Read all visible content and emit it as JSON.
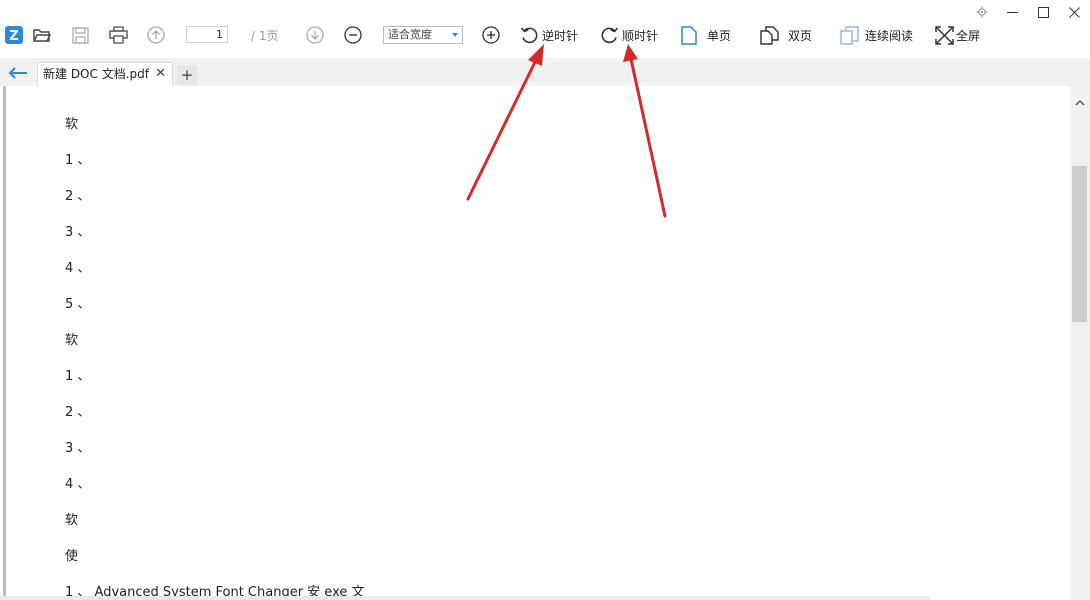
{
  "window": {
    "settings_icon": "gear-icon",
    "minimize_icon": "minimize-icon",
    "maximize_icon": "maximize-icon",
    "close_icon": "close-icon"
  },
  "toolbar": {
    "page_current": "1",
    "page_total": "/ 1页",
    "zoom_value": "适合宽度",
    "rotate_ccw_label": "逆时针",
    "rotate_cw_label": "顺时针",
    "single_page_label": "单页",
    "double_page_label": "双页",
    "continuous_label": "连续阅读",
    "fullscreen_label": "全屏"
  },
  "tabs": {
    "active_label": "新建 DOC 文档.pdf",
    "close_glyph": "✕",
    "add_glyph": "+"
  },
  "document": {
    "lines": [
      "软",
      "1 、",
      "2 、",
      "3 、",
      "4 、",
      "5 、",
      "软",
      "1 、",
      "2 、",
      "3 、",
      "4 、",
      "软",
      "使",
      "1 、 Advanced System Font Changer 安 exe 文"
    ]
  },
  "colors": {
    "accent": "#2a8ad8",
    "annotation_arrow": "#d42a2a",
    "icon_gray": "#555555"
  }
}
